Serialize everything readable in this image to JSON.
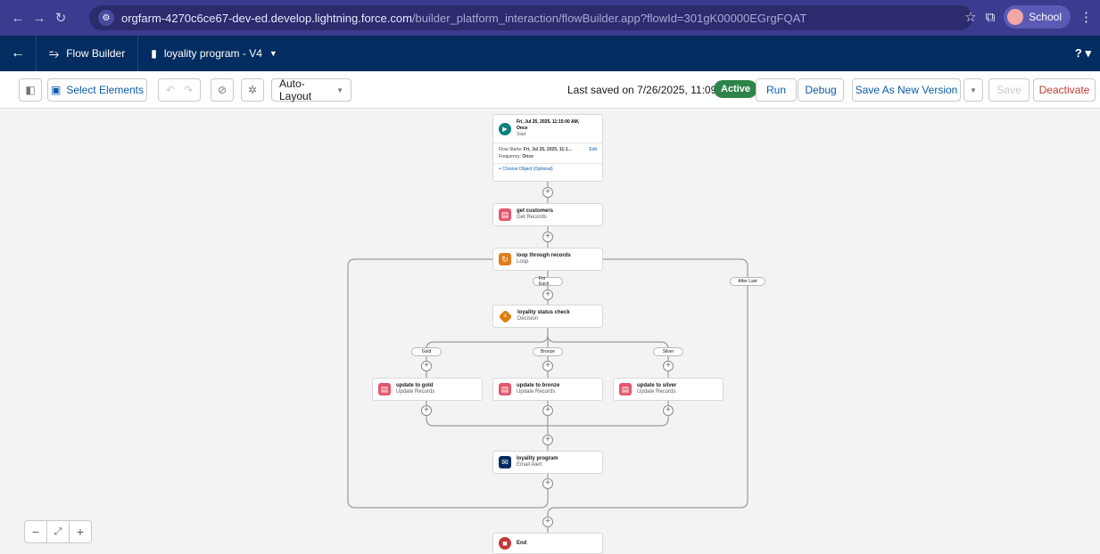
{
  "browser": {
    "url_host": "orgfarm-4270c6ce67-dev-ed.develop.lightning.force.com",
    "url_path": "/builder_platform_interaction/flowBuilder.app?flowId=301gK00000EGrgFQAT",
    "profile_label": "School"
  },
  "header": {
    "app_name": "Flow Builder",
    "flow_name": "loyality program - V4",
    "help": "?"
  },
  "toolbar": {
    "select_elements": "Select Elements",
    "layout_mode": "Auto-Layout",
    "last_saved": "Last saved on 7/26/2025, 11:09 AM",
    "status": "Active",
    "run": "Run",
    "debug": "Debug",
    "save_as_new_version": "Save As New Version",
    "save": "Save",
    "deactivate": "Deactivate"
  },
  "canvas": {
    "start": {
      "title": "Fri, Jul 25, 2025, 11:15:00 AM,",
      "title2": "Once",
      "type": "Start",
      "flow_starts_label": "Flow Starts:",
      "flow_starts_value": "Fri, Jul 25, 2025, 11:1...",
      "edit": "Edit",
      "frequency_label": "Frequency:",
      "frequency_value": "Once",
      "choose_object": "+ Choose Object (Optional)"
    },
    "get_customers": {
      "title": "get customers",
      "type": "Get Records"
    },
    "loop": {
      "title": "loop through records",
      "type": "Loop",
      "for_each": "For Each",
      "after_last": "After Last"
    },
    "decision": {
      "title": "loyality status check",
      "type": "Decision"
    },
    "branches": [
      {
        "label": "Gold",
        "title": "update to gold",
        "type": "Update Records"
      },
      {
        "label": "Bronze",
        "title": "update to bronze",
        "type": "Update Records"
      },
      {
        "label": "Silver",
        "title": "update to silver",
        "type": "Update Records"
      }
    ],
    "email": {
      "title": "loyality program",
      "type": "Email Alert"
    },
    "end": {
      "title": "End"
    }
  },
  "colors": {
    "chrome": "#3b3b8f",
    "sf_header": "#032d60",
    "active_badge": "#2e844a",
    "start_icon": "#0b827c",
    "records_icon": "#e3566b",
    "loop_icon": "#e27d1c",
    "decision_icon": "#dd7a01",
    "email_icon": "#032d60",
    "end_icon": "#c23934"
  }
}
